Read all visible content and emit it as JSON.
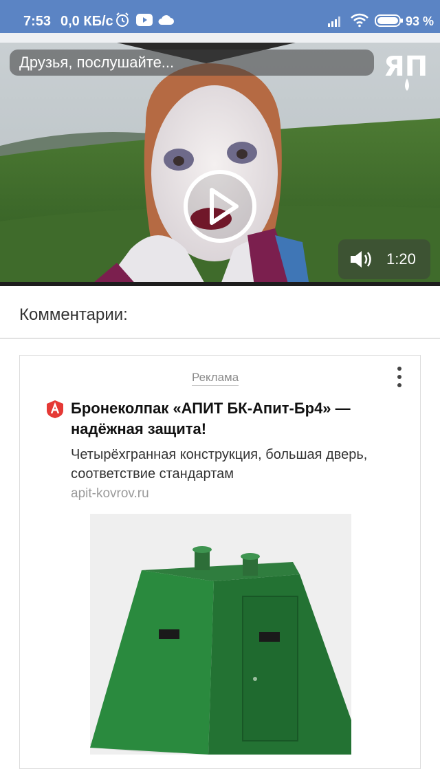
{
  "status_bar": {
    "time": "7:53",
    "speed": "0,0 КБ/с",
    "battery": "93 %",
    "icons": [
      "alarm-icon",
      "youtube-icon",
      "cloud-icon",
      "signal-icon",
      "wifi-icon",
      "battery-icon"
    ]
  },
  "video": {
    "title": "Друзья, послушайте...",
    "duration": "1:20",
    "logo_text": "ЯП",
    "icons": [
      "play-icon",
      "volume-icon"
    ]
  },
  "comments": {
    "header": "Комментарии:"
  },
  "ad": {
    "label": "Реклама",
    "headline": "Бронеколпак «АПИТ БК-Апит-Бр4» — надёжная защита!",
    "description": "Четырёхгранная конструкция, большая дверь, соответствие стандартам",
    "domain": "apit-kovrov.ru",
    "brand_color": "#e53935",
    "icons": [
      "brand-logo-icon",
      "more-vertical-icon"
    ]
  },
  "colors": {
    "status_bar": "#5b84c4",
    "text_primary": "#111111",
    "text_muted": "#9a9a9a"
  }
}
